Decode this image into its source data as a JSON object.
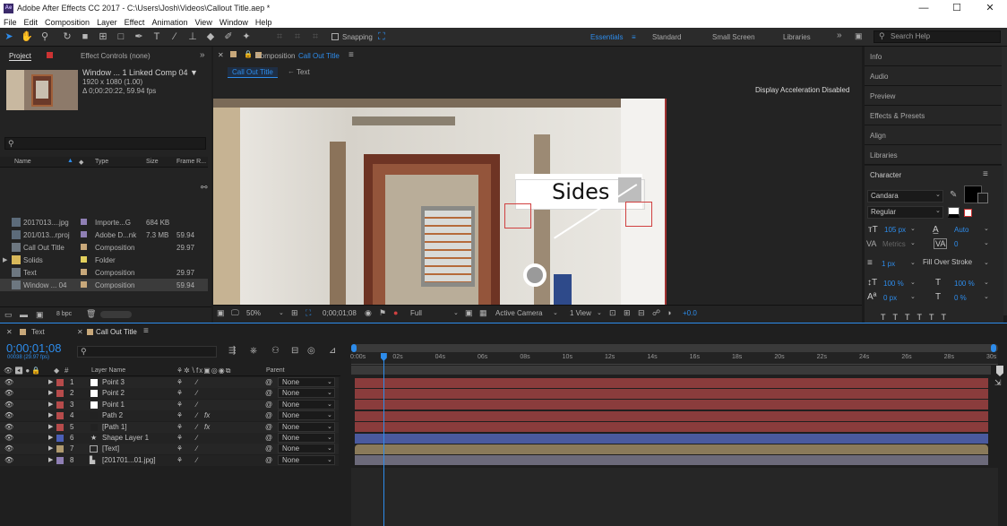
{
  "app": {
    "title": "Adobe After Effects CC 2017 - C:\\Users\\Josh\\Videos\\Callout Title.aep *",
    "logo": "Ae"
  },
  "window_controls": {
    "minimize": "—",
    "maximize": "☐",
    "close": "✕"
  },
  "menu": [
    "File",
    "Edit",
    "Composition",
    "Layer",
    "Effect",
    "Animation",
    "View",
    "Window",
    "Help"
  ],
  "toolbar": {
    "snapping": "Snapping",
    "workspaces": [
      "Essentials",
      "Standard",
      "Small Screen",
      "Libraries"
    ],
    "active_workspace": "Essentials",
    "search_placeholder": "Search Help"
  },
  "project_panel": {
    "tabs": [
      "Project",
      "Effect Controls (none)"
    ],
    "selected_item": {
      "name": "Window ... 1 Linked Comp 04 ▼",
      "res": "1920 x 1080 (1.00)",
      "duration": "Δ 0;00:20:22, 59.94 fps"
    },
    "search_placeholder": "",
    "columns": [
      "Name",
      "Type",
      "Size",
      "Frame R..."
    ],
    "items": [
      {
        "name": "2017013....jpg",
        "type": "Importe...G",
        "size": "684 KB",
        "rate": "",
        "color": "#8f7fb4",
        "icon": "image-icon"
      },
      {
        "name": "201/013...rproj",
        "type": "Adobe D...nk",
        "size": "7.3 MB",
        "rate": "59.94",
        "color": "#8f7fb4",
        "icon": "premiere-project-icon"
      },
      {
        "name": "Call Out Title",
        "type": "Composition",
        "size": "",
        "rate": "29.97",
        "color": "#c8a87a",
        "icon": "composition-icon"
      },
      {
        "name": "Solids",
        "type": "Folder",
        "size": "",
        "rate": "",
        "color": "#e3d05c",
        "icon": "folder-icon"
      },
      {
        "name": "Text",
        "type": "Composition",
        "size": "",
        "rate": "29.97",
        "color": "#c8a87a",
        "icon": "composition-icon"
      },
      {
        "name": "Window ... 04",
        "type": "Composition",
        "size": "",
        "rate": "59.94",
        "color": "#c8a87a",
        "icon": "composition-icon"
      }
    ],
    "bpc": "8 bpc"
  },
  "composition_panel": {
    "header": "Composition",
    "comp_name": "Call Out Title",
    "tabs": [
      "Call Out Title",
      "Text"
    ],
    "notice": "Display Acceleration Disabled",
    "callout_text": "Sides",
    "footer": {
      "zoom": "50%",
      "timecode": "0;00;01;08",
      "resolution": "Full",
      "camera": "Active Camera",
      "view": "1 View",
      "exposure": "+0.0"
    }
  },
  "right_panels": [
    "Info",
    "Audio",
    "Preview",
    "Effects & Presets",
    "Align",
    "Libraries"
  ],
  "character": {
    "title": "Character",
    "font": "Candara",
    "style": "Regular",
    "size": "105 px",
    "leading": "Auto",
    "kerning": "Metrics",
    "tracking": "0",
    "stroke_width": "1 px",
    "stroke_type": "Fill Over Stroke",
    "vscale": "100 %",
    "hscale": "100 %",
    "baseline": "0 px",
    "tsume": "0 %"
  },
  "timeline": {
    "tabs": [
      "Text",
      "Call Out Title"
    ],
    "timecode": "0;00;01;08",
    "subtimecode": "00038 (29.97 fps)",
    "col_layer": "Layer Name",
    "col_parent": "Parent",
    "ruler": [
      "0:00s",
      "02s",
      "04s",
      "06s",
      "08s",
      "10s",
      "12s",
      "14s",
      "16s",
      "18s",
      "20s",
      "22s",
      "24s",
      "26s",
      "28s",
      "30s"
    ],
    "playhead_fraction": 0.045,
    "layers": [
      {
        "num": "1",
        "name": "Point 3",
        "color": "#b64b4b",
        "icon": "solid-icon",
        "parent": "None",
        "bar": "#8a3c3c",
        "fx": false
      },
      {
        "num": "2",
        "name": "Point 2",
        "color": "#b64b4b",
        "icon": "solid-icon",
        "parent": "None",
        "bar": "#8a3c3c",
        "fx": false
      },
      {
        "num": "3",
        "name": "Point 1",
        "color": "#b64b4b",
        "icon": "solid-icon",
        "parent": "None",
        "bar": "#8a3c3c",
        "fx": false
      },
      {
        "num": "4",
        "name": "Path 2",
        "color": "#b64b4b",
        "icon": "solid-icon",
        "parent": "None",
        "bar": "#8a3c3c",
        "fx": true
      },
      {
        "num": "5",
        "name": "[Path 1]",
        "color": "#b64b4b",
        "icon": "solid-icon",
        "parent": "None",
        "bar": "#8a3c3c",
        "fx": true
      },
      {
        "num": "6",
        "name": "Shape Layer 1",
        "color": "#4b5fb6",
        "icon": "star-icon",
        "parent": "None",
        "bar": "#4a5a9e",
        "fx": false
      },
      {
        "num": "7",
        "name": "[Text]",
        "color": "#b09a6f",
        "icon": "composition-icon",
        "parent": "None",
        "bar": "#8a7a5a",
        "fx": false
      },
      {
        "num": "8",
        "name": "[201701...01.jpg]",
        "color": "#8f7fb4",
        "icon": "image-icon",
        "parent": "None",
        "bar": "#6c6a7a",
        "fx": false
      }
    ]
  }
}
